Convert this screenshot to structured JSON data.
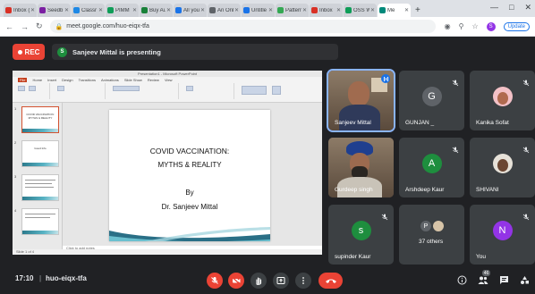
{
  "browser": {
    "tabs": [
      {
        "label": "Inbox (",
        "color": "#d93025"
      },
      {
        "label": "Seedb",
        "color": "#7b1fa2"
      },
      {
        "label": "Classr",
        "color": "#1e88e5"
      },
      {
        "label": "PIMM",
        "color": "#0f9d58"
      },
      {
        "label": "Buy Au",
        "color": "#188038"
      },
      {
        "label": "All you",
        "color": "#1a73e8"
      },
      {
        "label": "An Onl",
        "color": "#5f6368"
      },
      {
        "label": "Untitle",
        "color": "#1a73e8"
      },
      {
        "label": "Pattern",
        "color": "#34a853"
      },
      {
        "label": "Inbox",
        "color": "#d93025"
      },
      {
        "label": "OSS W",
        "color": "#0f9d58"
      },
      {
        "label": "Me",
        "color": "#00897b"
      }
    ],
    "new_tab": "+",
    "url": "meet.google.com/huo-eiqx-tfa",
    "profile_initial": "S",
    "update_label": "Update",
    "window_controls": [
      "—",
      "□",
      "✕"
    ],
    "icons": [
      "back-icon",
      "forward-icon",
      "reload-icon",
      "lock-icon",
      "camera-icon",
      "zoom-icon",
      "star-icon"
    ]
  },
  "meet": {
    "rec_label": "REC",
    "presenting_initial": "S",
    "presenting_text": "Sanjeev Mittal is presenting",
    "time": "17:10",
    "separator": "|",
    "meeting_code": "huo-eiqx-tfa",
    "people_count": "46"
  },
  "presentation": {
    "app_title": "Presentation1 - Microsoft PowerPoint",
    "ribbon_tabs": [
      "File",
      "Home",
      "Insert",
      "Design",
      "Transitions",
      "Animations",
      "Slide Show",
      "Review",
      "View"
    ],
    "thumb_numbers": [
      "1",
      "2",
      "3",
      "4"
    ],
    "thumbs": [
      "COVID VACCINATION: MYTHS & REALITY",
      "Good Info",
      "",
      ""
    ],
    "slide": {
      "title_line1": "COVID VACCINATION:",
      "title_line2": "MYTHS & REALITY",
      "by": "By",
      "author": "Dr. Sanjeev Mittal"
    },
    "notes_placeholder": "Click to add notes",
    "status": "Slide 1 of 4"
  },
  "participants": [
    {
      "name": "Sanjeev Mittal",
      "type": "video",
      "muted": false,
      "speaking": true
    },
    {
      "name": "GUNJAN _",
      "type": "avatar",
      "initial": "G",
      "color": "#5f6368",
      "muted": true
    },
    {
      "name": "Kanika Sofat",
      "type": "photo",
      "muted": true
    },
    {
      "name": "Gurdeep singh",
      "type": "video",
      "muted": false
    },
    {
      "name": "Arshdeep Kaur",
      "type": "avatar",
      "initial": "A",
      "color": "#1e8e3e",
      "muted": true
    },
    {
      "name": "SHIVANI",
      "type": "photo",
      "muted": true
    },
    {
      "name": "supinder Kaur",
      "type": "avatar",
      "initial": "s",
      "color": "#1e8e3e",
      "muted": true
    },
    {
      "name": "37 others",
      "type": "group",
      "initial": "P",
      "muted": false
    },
    {
      "name": "You",
      "type": "avatar",
      "initial": "N",
      "color": "#9334e6",
      "muted": true
    }
  ]
}
